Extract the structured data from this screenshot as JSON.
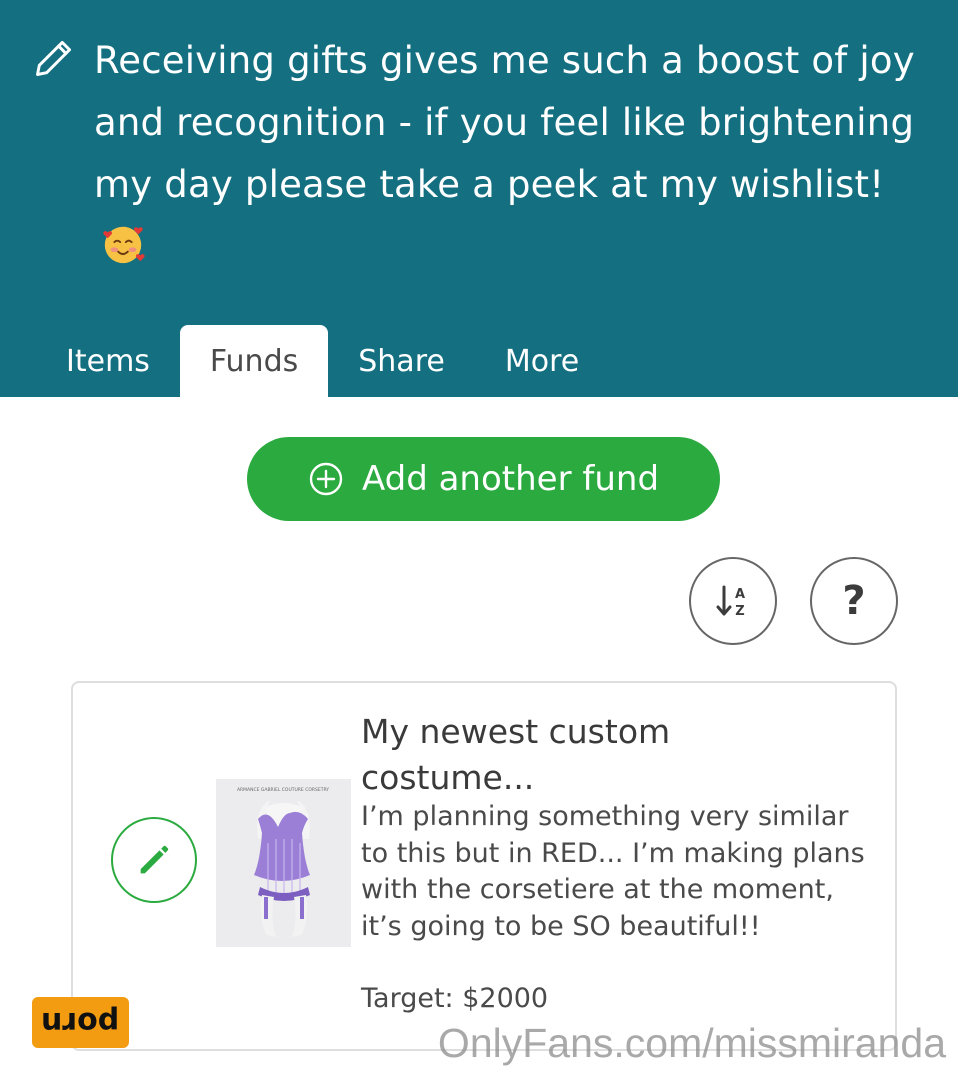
{
  "header": {
    "bio_text": "Receiving gifts gives me such a boost of joy and recognition - if you feel like brightening my day please take a peek at my wishlist!",
    "bio_emoji": "smiling-face-with-hearts",
    "colors": {
      "background": "#146f80",
      "text": "#ffffff"
    }
  },
  "tabs": [
    {
      "label": "Items",
      "active": false
    },
    {
      "label": "Funds",
      "active": true
    },
    {
      "label": "Share",
      "active": false
    },
    {
      "label": "More",
      "active": false
    }
  ],
  "actions": {
    "add_fund_label": "Add another fund",
    "add_fund_color": "#2aaa3f",
    "sort_icon": "sort-alpha-icon",
    "sort_glyph_top": "A",
    "sort_glyph_bottom": "Z",
    "help_label": "?"
  },
  "fund": {
    "title": "My newest custom costume...",
    "description": "I’m planning something very similar to this but in RED... I’m making plans with the corsetiere at the moment, it’s going to be SO beautiful!!",
    "target": "Target: $2000",
    "image_caption": "ARMANCE GABRIEL COUTURE CORSETRY"
  },
  "watermark": {
    "logo_text": "porn",
    "site_text": "OnlyFans.com/missmiranda"
  }
}
